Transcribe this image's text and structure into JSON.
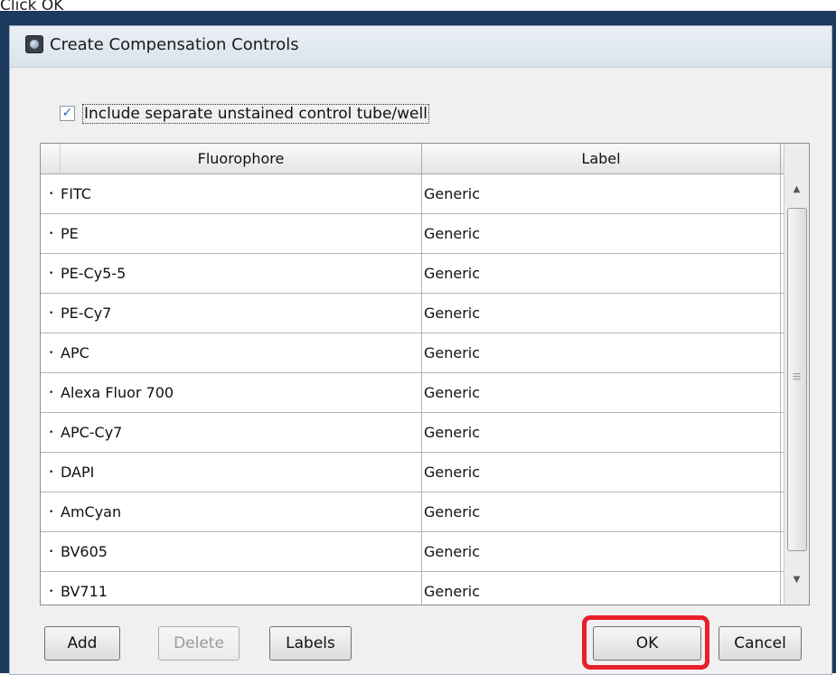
{
  "doc_caption": "Click OK",
  "window": {
    "title": "Create Compensation Controls"
  },
  "options": {
    "include_unstained_label": "Include separate unstained control tube/well",
    "include_unstained_checked": true
  },
  "table": {
    "columns": [
      "Fluorophore",
      "Label"
    ],
    "rows": [
      {
        "fluorophore": "FITC",
        "label": "Generic"
      },
      {
        "fluorophore": "PE",
        "label": "Generic"
      },
      {
        "fluorophore": "PE-Cy5-5",
        "label": "Generic"
      },
      {
        "fluorophore": "PE-Cy7",
        "label": "Generic"
      },
      {
        "fluorophore": "APC",
        "label": "Generic"
      },
      {
        "fluorophore": "Alexa Fluor 700",
        "label": "Generic"
      },
      {
        "fluorophore": "APC-Cy7",
        "label": "Generic"
      },
      {
        "fluorophore": "DAPI",
        "label": "Generic"
      },
      {
        "fluorophore": "AmCyan",
        "label": "Generic"
      },
      {
        "fluorophore": "BV605",
        "label": "Generic"
      },
      {
        "fluorophore": "BV711",
        "label": "Generic"
      }
    ]
  },
  "buttons": {
    "add": "Add",
    "delete": "Delete",
    "labels": "Labels",
    "ok": "OK",
    "cancel": "Cancel"
  },
  "icons": {
    "checkbox_check": "✓",
    "row_handle": "•"
  },
  "colors": {
    "highlight": "#e8202a"
  }
}
